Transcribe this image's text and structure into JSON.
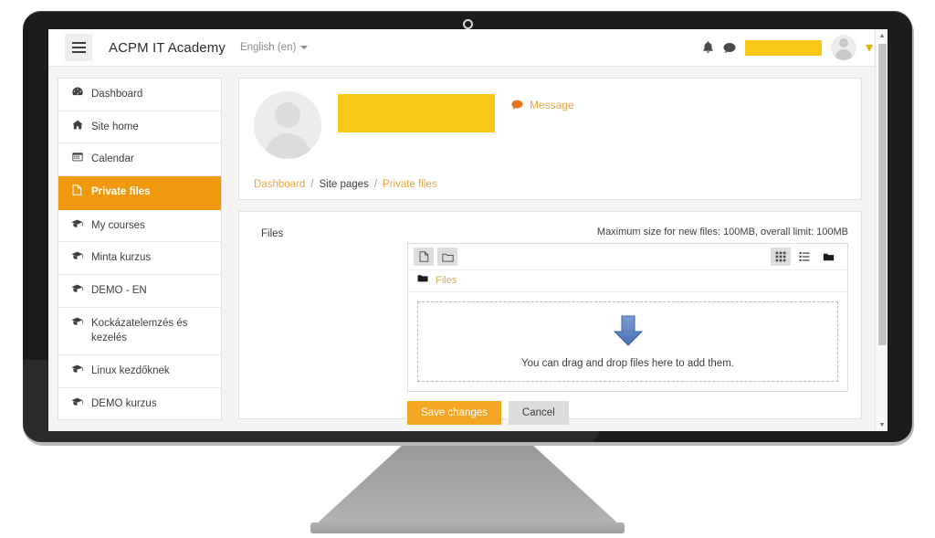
{
  "navbar": {
    "hamburger_label": "menu-toggle",
    "site_title": "ACPM IT Academy",
    "language": "English (en)",
    "bell_glyph": "ὑ4",
    "chat_glyph": "●",
    "user_caret": "▾",
    "username_redacted": ""
  },
  "sidebar": {
    "items": [
      {
        "label": "Dashboard",
        "icon": "dashboard-icon",
        "glyph": "☲",
        "active": false
      },
      {
        "label": "Site home",
        "icon": "home-icon",
        "glyph": "⌂",
        "active": false
      },
      {
        "label": "Calendar",
        "icon": "calendar-icon",
        "glyph": "Ὄ5",
        "active": false
      },
      {
        "label": "Private files",
        "icon": "file-icon",
        "glyph": "὜E",
        "active": true
      },
      {
        "label": "My courses",
        "icon": "graduation-cap-icon",
        "glyph": "Ἱ3",
        "active": false
      },
      {
        "label": "Minta kurzus",
        "icon": "graduation-cap-icon",
        "glyph": "Ἱ3",
        "active": false
      },
      {
        "label": "DEMO - EN",
        "icon": "graduation-cap-icon",
        "glyph": "Ἱ3",
        "active": false
      },
      {
        "label": "Kockázatelemzés és kezelés",
        "icon": "graduation-cap-icon",
        "glyph": "Ἱ3",
        "active": false
      },
      {
        "label": "Linux kezdőknek",
        "icon": "graduation-cap-icon",
        "glyph": "Ἱ3",
        "active": false
      },
      {
        "label": "DEMO kurzus",
        "icon": "graduation-cap-icon",
        "glyph": "Ἱ3",
        "active": false
      }
    ]
  },
  "profile": {
    "name_redacted": "",
    "message_label": "Message",
    "message_icon": "ὊC"
  },
  "breadcrumb": {
    "items": [
      {
        "label": "Dashboard",
        "current": false
      },
      {
        "label": "Site pages",
        "current": true
      },
      {
        "label": "Private files",
        "current": false
      }
    ],
    "separator": "/"
  },
  "files_section": {
    "label": "Files",
    "max_size_note": "Maximum size for new files: 100MB, overall limit: 100MB",
    "toolbar": {
      "add_file_glyph": "὜B",
      "create_folder_glyph": "὜0",
      "grid_view_glyph": "☷",
      "list_view_glyph": "☰",
      "tree_view_glyph": "▰"
    },
    "fm_breadcrumb": {
      "folder_glyph": "▰",
      "label": "Files"
    },
    "dropzone_text": "You can drag and drop files here to add them."
  },
  "form": {
    "save_label": "Save changes",
    "cancel_label": "Cancel"
  },
  "scrollbar": {
    "up_glyph": "▲",
    "down_glyph": "▼"
  },
  "colors": {
    "accent_orange": "#f0990f",
    "button_orange": "#f5a623",
    "redaction_yellow": "#fbc81a",
    "link_orange": "#e9a63c",
    "bezel_dark": "#1c1c1c",
    "stand_gray": "#a6a6a6",
    "dropzone_arrow_blue": "#5b82c4"
  }
}
